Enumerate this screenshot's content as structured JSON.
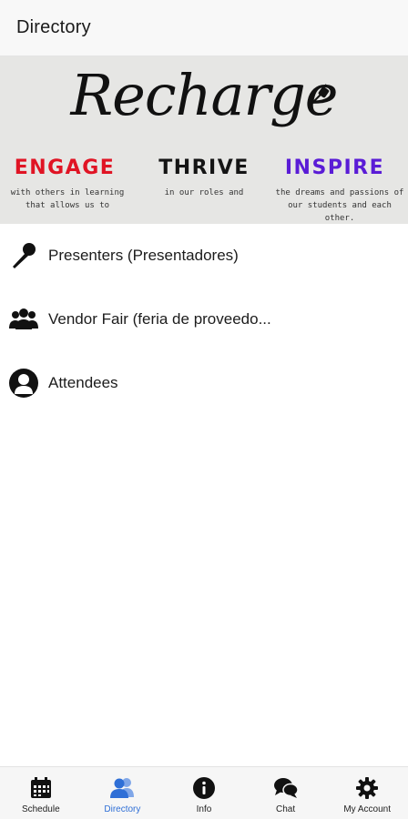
{
  "header": {
    "title": "Directory"
  },
  "banner": {
    "logo_text": "Recharge",
    "words": [
      {
        "label": "ENGAGE",
        "subtext": "with others in learning that allows us to",
        "color": "#e01424"
      },
      {
        "label": "THRIVE",
        "subtext": "in our roles and",
        "color": "#141414"
      },
      {
        "label": "INSPIRE",
        "subtext": "the dreams and passions of our students and each other.",
        "color": "#5a1cd6"
      }
    ]
  },
  "list": {
    "items": [
      {
        "label": "Presenters (Presentadores)",
        "icon": "microphone-icon"
      },
      {
        "label": "Vendor Fair (feria de proveedo...",
        "icon": "group-icon"
      },
      {
        "label": "Attendees",
        "icon": "person-circle-icon"
      }
    ]
  },
  "tabs": [
    {
      "label": "Schedule",
      "icon": "calendar-icon",
      "active": false
    },
    {
      "label": "Directory",
      "icon": "people-icon",
      "active": true
    },
    {
      "label": "Info",
      "icon": "info-icon",
      "active": false
    },
    {
      "label": "Chat",
      "icon": "chat-icon",
      "active": false
    },
    {
      "label": "My Account",
      "icon": "gear-icon",
      "active": false
    }
  ],
  "colors": {
    "active_tab": "#2f6fd6",
    "engage": "#e01424",
    "inspire": "#5a1cd6"
  }
}
